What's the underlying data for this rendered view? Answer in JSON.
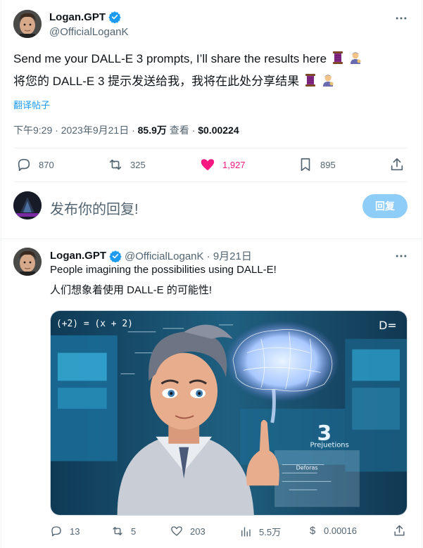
{
  "main_tweet": {
    "display_name": "Logan.GPT",
    "handle": "@OfficialLoganK",
    "text_en": "Send me your DALL-E 3 prompts, I’ll share the results here",
    "text_zh": "将您的 DALL-E 3 提示发送给我，我将在此处分享结果",
    "translate_label": "翻译帖子",
    "time": "下午9:29 · 2023年9月21日 · ",
    "views_value": "85.9万",
    "views_label": " 查看 · ",
    "price": "$0.00224",
    "replies": "870",
    "retweets": "325",
    "likes": "1,927",
    "bookmarks": "895"
  },
  "reply": {
    "placeholder": "发布你的回复!",
    "button_label": "回复"
  },
  "second_tweet": {
    "display_name": "Logan.GPT",
    "handle_and_date": "@OfficialLoganK · 9月21日",
    "text_en": "People imagining the possibilities using DALL-E!",
    "text_zh": "人们想象着使用 DALL-E 的可能性!",
    "replies": "13",
    "retweets": "5",
    "likes": "203",
    "views": "5.5万",
    "tips_symbol": "$",
    "tips": "0.00016"
  },
  "image_text": {
    "formula_left": "(+2) = (x + 2)",
    "formula_right": "D=",
    "big_number": "3",
    "projections_label": "Prejuetions",
    "panel_label": "Deforas"
  },
  "colors": {
    "like_pink": "#f91880",
    "verified_blue": "#1d9bf0",
    "reply_button": "#8ecdf8"
  }
}
